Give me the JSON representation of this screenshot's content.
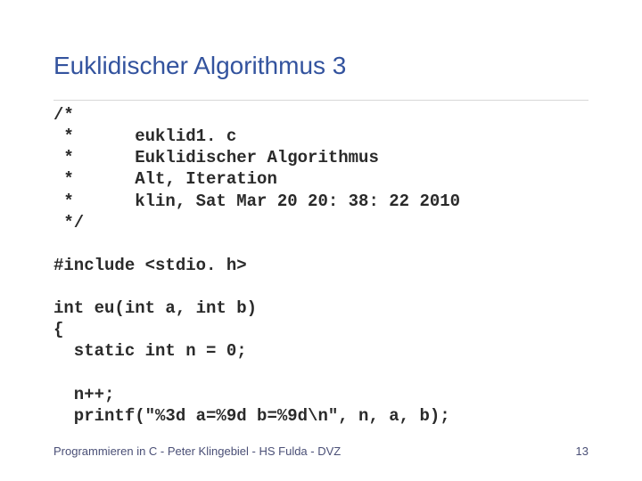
{
  "title": "Euklidischer Algorithmus 3",
  "code": "/*\n *      euklid1. c\n *      Euklidischer Algorithmus\n *      Alt, Iteration\n *      klin, Sat Mar 20 20: 38: 22 2010\n */\n\n#include <stdio. h>\n\nint eu(int a, int b)\n{\n  static int n = 0;\n\n  n++;\n  printf(\"%3d a=%9d b=%9d\\n\", n, a, b);",
  "footer": {
    "left": "Programmieren in C - Peter Klingebiel - HS Fulda - DVZ",
    "right": "13"
  }
}
